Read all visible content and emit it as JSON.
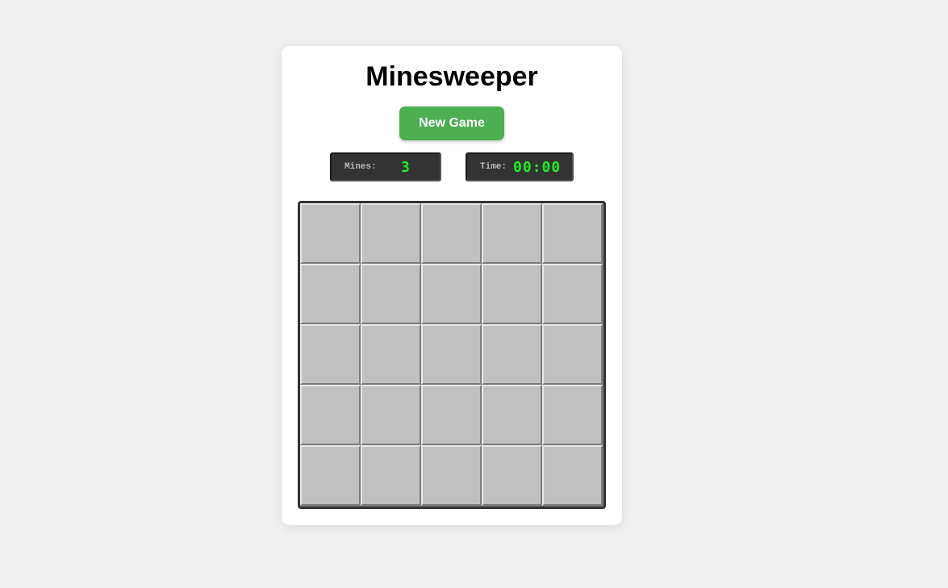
{
  "game": {
    "title": "Minesweeper",
    "new_game_label": "New Game",
    "mines_label": "Mines:",
    "mines_value": "3",
    "time_label": "Time:",
    "time_value": "00:00",
    "board": {
      "rows": 5,
      "cols": 5,
      "cell_state": "hidden"
    }
  },
  "colors": {
    "background": "#f0f0f0",
    "card": "#ffffff",
    "button": "#4caf50",
    "counter_bg": "#333333",
    "counter_text": "#22ee22",
    "cell": "#c0c0c0"
  }
}
